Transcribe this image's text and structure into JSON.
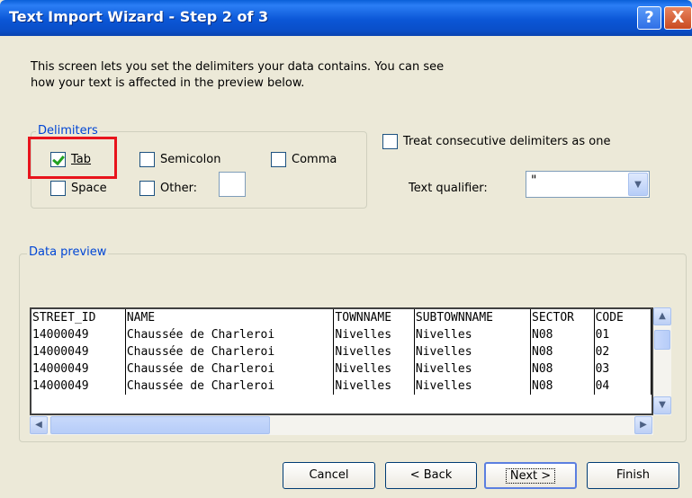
{
  "window": {
    "title": "Text Import Wizard - Step 2 of 3",
    "help_glyph": "?",
    "close_glyph": "X"
  },
  "description": {
    "line1": "This screen lets you set the delimiters your data contains.  You can see",
    "line2": "how your text is affected in the preview below."
  },
  "delimiters": {
    "group_label": "Delimiters",
    "tab": {
      "label": "Tab",
      "checked": true
    },
    "semicolon": {
      "label": "Semicolon",
      "checked": false
    },
    "comma": {
      "label": "Comma",
      "checked": false
    },
    "space": {
      "label": "Space",
      "checked": false
    },
    "other": {
      "label": "Other:",
      "checked": false,
      "value": ""
    }
  },
  "consecutive": {
    "label": "Treat consecutive delimiters as one",
    "checked": false
  },
  "qualifier": {
    "label": "Text qualifier:",
    "value": "\""
  },
  "preview": {
    "group_label": "Data preview",
    "headers": [
      "STREET_ID",
      "NAME",
      "TOWNNAME",
      "SUBTOWNNAME",
      "SECTOR",
      "CODE"
    ],
    "rows": [
      [
        "14000049",
        "Chaussée de Charleroi",
        "Nivelles",
        "Nivelles",
        "N08",
        "01"
      ],
      [
        "14000049",
        "Chaussée de Charleroi",
        "Nivelles",
        "Nivelles",
        "N08",
        "02"
      ],
      [
        "14000049",
        "Chaussée de Charleroi",
        "Nivelles",
        "Nivelles",
        "N08",
        "03"
      ],
      [
        "14000049",
        "Chaussée de Charleroi",
        "Nivelles",
        "Nivelles",
        "N08",
        "04"
      ]
    ]
  },
  "buttons": {
    "cancel": "Cancel",
    "back": "< Back",
    "next": "Next >",
    "finish": "Finish"
  },
  "colors": {
    "title_bar": "#0b56d6",
    "highlight": "#e8141c",
    "group_label": "#0046d5"
  }
}
